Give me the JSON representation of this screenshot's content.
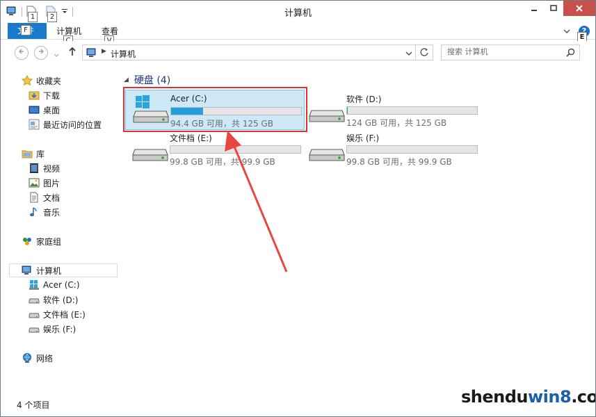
{
  "window": {
    "title": "计算机"
  },
  "qat": {
    "keytip_1": "1",
    "keytip_2": "2"
  },
  "ribbon": {
    "file_label": "文件",
    "file_keytip": "F",
    "tabs": [
      {
        "label": "计算机",
        "keytip": "C"
      },
      {
        "label": "查看",
        "keytip": "V"
      }
    ],
    "help_keytip": "E"
  },
  "address": {
    "crumb": "计算机"
  },
  "search": {
    "placeholder": "搜索 计算机"
  },
  "nav": {
    "favorites": {
      "label": "收藏夹",
      "items": [
        "下载",
        "桌面",
        "最近访问的位置"
      ]
    },
    "libraries": {
      "label": "库",
      "items": [
        "视频",
        "图片",
        "文档",
        "音乐"
      ]
    },
    "homegroup": {
      "label": "家庭组"
    },
    "computer": {
      "label": "计算机",
      "items": [
        "Acer (C:)",
        "软件 (D:)",
        "文件档 (E:)",
        "娱乐 (F:)"
      ]
    },
    "network": {
      "label": "网络"
    }
  },
  "content": {
    "group_title": "硬盘 (4)",
    "drives": [
      {
        "name": "Acer (C:)",
        "info": "94.4 GB 可用，共 125 GB",
        "used_fraction": 0.245,
        "system": true
      },
      {
        "name": "软件 (D:)",
        "info": "124 GB 可用，共 125 GB",
        "used_fraction": 0.008,
        "system": false
      },
      {
        "name": "文件档 (E:)",
        "info": "99.8 GB 可用，共 99.9 GB",
        "used_fraction": 0.0,
        "system": false
      },
      {
        "name": "娱乐 (F:)",
        "info": "99.8 GB 可用，共 99.9 GB",
        "used_fraction": 0.0,
        "system": false
      }
    ]
  },
  "status": {
    "item_count": "4 个项目"
  },
  "watermark": {
    "pre": "shendu",
    "win": "win8",
    "post": ".com"
  },
  "colors": {
    "accent": "#1979ca",
    "bar_fill": "#26a0da",
    "selection": "#cde8f7",
    "highlight_box": "#e03030",
    "arrow": "#e8463f"
  }
}
